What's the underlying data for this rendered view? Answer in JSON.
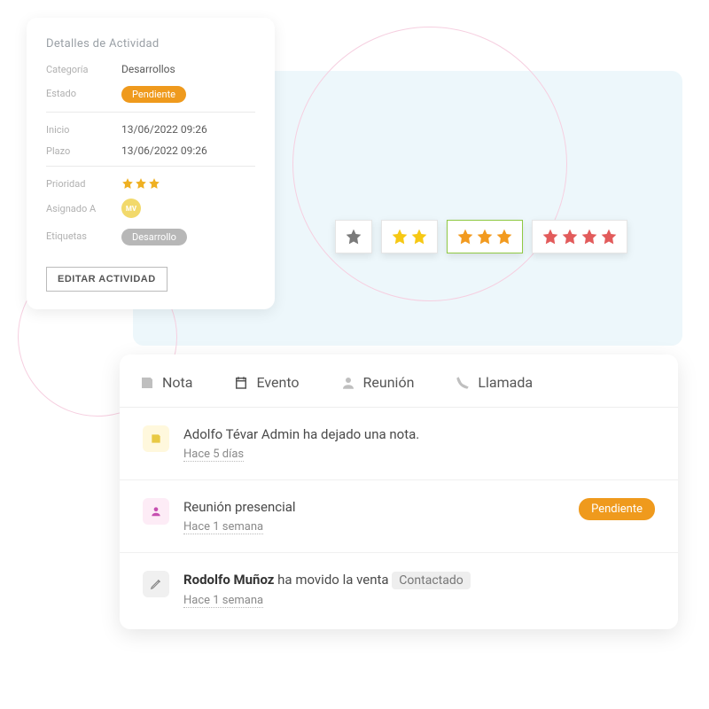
{
  "details": {
    "title": "Detalles de Actividad",
    "labels": {
      "categoria": "Categoría",
      "estado": "Estado",
      "inicio": "Inicio",
      "plazo": "Plazo",
      "prioridad": "Prioridad",
      "asignado": "Asignado A",
      "etiquetas": "Etiquetas"
    },
    "categoria": "Desarrollos",
    "estado": "Pendiente",
    "inicio": "13/06/2022 09:26",
    "plazo": "13/06/2022 09:26",
    "prioridad_stars": 3,
    "asignado_initials": "MV",
    "etiqueta": "Desarrollo",
    "edit_button": "EDITAR ACTIVIDAD"
  },
  "priority_picker": {
    "options": [
      1,
      2,
      3,
      4
    ],
    "selected": 3
  },
  "feed": {
    "tabs": {
      "nota": "Nota",
      "evento": "Evento",
      "reunion": "Reunión",
      "llamada": "Llamada"
    },
    "items": [
      {
        "text": "Adolfo Tévar Admin ha dejado una nota.",
        "time": "Hace 5 días"
      },
      {
        "text": "Reunión presencial",
        "time": "Hace 1 semana",
        "badge": "Pendiente"
      },
      {
        "actor": "Rodolfo Muñoz",
        "rest": " ha movido la venta ",
        "tag": "Contactado",
        "time": "Hace 1 semana"
      }
    ]
  }
}
